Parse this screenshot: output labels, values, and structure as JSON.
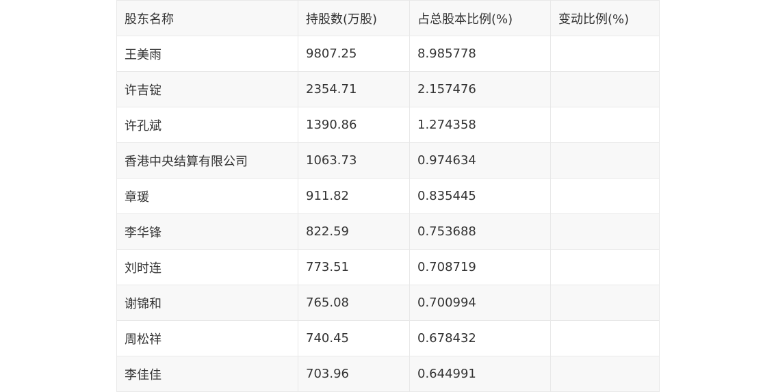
{
  "table": {
    "headers": [
      "股东名称",
      "持股数(万股)",
      "占总股本比例(%)",
      "变动比例(%)"
    ],
    "rows": [
      [
        "王美雨",
        "9807.25",
        "8.985778",
        ""
      ],
      [
        "许吉锭",
        "2354.71",
        "2.157476",
        ""
      ],
      [
        "许孔斌",
        "1390.86",
        "1.274358",
        ""
      ],
      [
        "香港中央结算有限公司",
        "1063.73",
        "0.974634",
        ""
      ],
      [
        "章瑗",
        "911.82",
        "0.835445",
        ""
      ],
      [
        "李华锋",
        "822.59",
        "0.753688",
        ""
      ],
      [
        "刘时连",
        "773.51",
        "0.708719",
        ""
      ],
      [
        "谢锦和",
        "765.08",
        "0.700994",
        ""
      ],
      [
        "周松祥",
        "740.45",
        "0.678432",
        ""
      ],
      [
        "李佳佳",
        "703.96",
        "0.644991",
        ""
      ]
    ]
  }
}
